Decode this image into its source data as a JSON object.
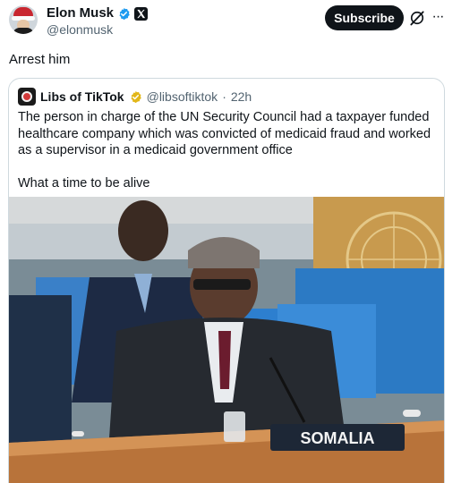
{
  "author": {
    "name": "Elon Musk",
    "handle": "@elonmusk",
    "subscribe_label": "Subscribe",
    "more_label": "···"
  },
  "post": {
    "text": "Arrest him"
  },
  "quoted": {
    "name": "Libs of TikTok",
    "handle": "@libsoftiktok",
    "dot": "·",
    "time": "22h",
    "text": "The person in charge of the UN Security Council had a taxpayer funded healthcare company which was convicted of medicaid fraud and worked as a supervisor in a medicaid government office",
    "text2": "What a time to be alive",
    "image": {
      "nameplate": "SOMALIA"
    }
  },
  "colors": {
    "verified_blue": "#1d9bf0",
    "verified_gold": "#e2b719",
    "subscribe_bg": "#0f1419",
    "secondary_text": "#536471"
  },
  "icons": [
    "verified-badge-icon",
    "x-logo-icon",
    "grok-icon",
    "more-icon",
    "gold-verified-badge-icon"
  ]
}
